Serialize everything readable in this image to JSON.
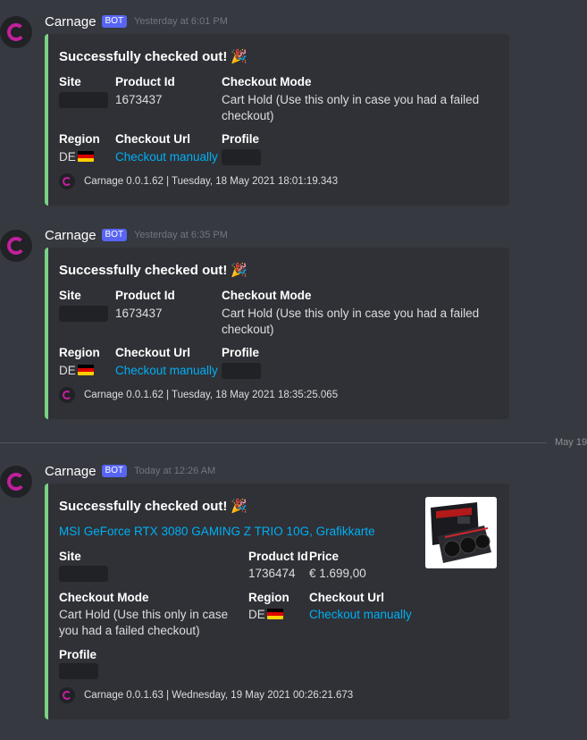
{
  "colors": {
    "accent_bar": "#7bd186",
    "link": "#00aff4",
    "bot_tag": "#5865f2",
    "background": "#36393f",
    "embed_bg": "#2f3136"
  },
  "messages": [
    {
      "username": "Carnage",
      "bot_tag": "BOT",
      "timestamp": "Yesterday at 6:01 PM",
      "embed": {
        "title": "Successfully checked out!",
        "title_emoji": "🎉",
        "fields": {
          "site_label": "Site",
          "product_id_label": "Product Id",
          "product_id": "1673437",
          "checkout_mode_label": "Checkout Mode",
          "checkout_mode": "Cart Hold (Use this only in case you had a failed checkout)",
          "region_label": "Region",
          "region": "DE",
          "checkout_url_label": "Checkout Url",
          "checkout_url": "Checkout manually",
          "profile_label": "Profile"
        },
        "footer": "Carnage 0.0.1.62 | Tuesday, 18 May 2021 18:01:19.343"
      }
    },
    {
      "username": "Carnage",
      "bot_tag": "BOT",
      "timestamp": "Yesterday at 6:35 PM",
      "embed": {
        "title": "Successfully checked out!",
        "title_emoji": "🎉",
        "fields": {
          "site_label": "Site",
          "product_id_label": "Product Id",
          "product_id": "1673437",
          "checkout_mode_label": "Checkout Mode",
          "checkout_mode": "Cart Hold (Use this only in case you had a failed checkout)",
          "region_label": "Region",
          "region": "DE",
          "checkout_url_label": "Checkout Url",
          "checkout_url": "Checkout manually",
          "profile_label": "Profile"
        },
        "footer": "Carnage 0.0.1.62 | Tuesday, 18 May 2021 18:35:25.065"
      }
    },
    {
      "username": "Carnage",
      "bot_tag": "BOT",
      "timestamp": "Today at 12:26 AM",
      "embed": {
        "title": "Successfully checked out!",
        "title_emoji": "🎉",
        "product_title": "MSI GeForce RTX 3080 GAMING Z TRIO 10G, Grafikkarte",
        "fields": {
          "site_label": "Site",
          "product_id_label": "Product Id",
          "product_id": "1736474",
          "price_label": "Price",
          "price": "€ 1.699,00",
          "checkout_mode_label": "Checkout Mode",
          "checkout_mode": "Cart Hold (Use this only in case you had a failed checkout)",
          "region_label": "Region",
          "region": "DE",
          "checkout_url_label": "Checkout Url",
          "checkout_url": "Checkout manually",
          "profile_label": "Profile"
        },
        "thumbnail": "graphics-card-image",
        "footer": "Carnage 0.0.1.63 | Wednesday, 19 May 2021 00:26:21.673"
      }
    }
  ],
  "date_divider": "May 19"
}
